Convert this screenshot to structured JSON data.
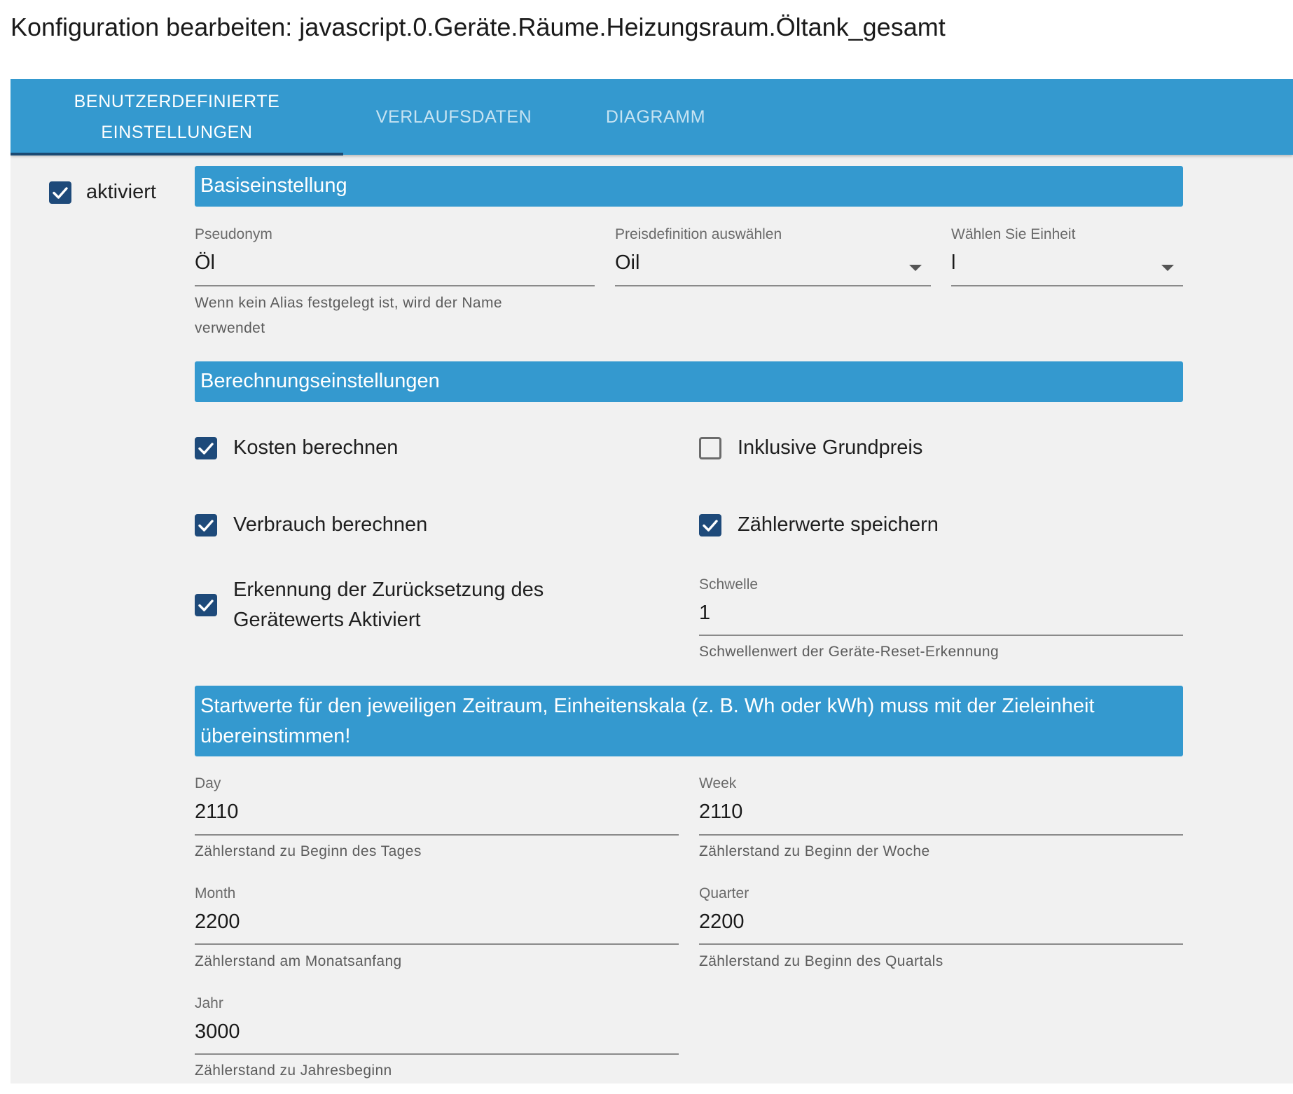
{
  "page": {
    "title": "Konfiguration bearbeiten: javascript.0.Geräte.Räume.Heizungsraum.Öltank_gesamt"
  },
  "tabs": [
    {
      "line1": "BENUTZERDEFINIERTE",
      "line2": "EINSTELLUNGEN",
      "active": true
    },
    {
      "label": "VERLAUFSDATEN",
      "active": false
    },
    {
      "label": "DIAGRAMM",
      "active": false
    }
  ],
  "enabled": {
    "label": "aktiviert",
    "checked": true
  },
  "basic": {
    "header": "Basiseinstellung",
    "alias": {
      "label": "Pseudonym",
      "value": "Öl",
      "helper": "Wenn kein Alias festgelegt ist, wird der Name verwendet"
    },
    "price": {
      "label": "Preisdefinition auswählen",
      "value": "Oil"
    },
    "unit": {
      "label": "Wählen Sie Einheit",
      "value": "l"
    }
  },
  "calc": {
    "header": "Berechnungseinstellungen",
    "costs": {
      "label": "Kosten berechnen",
      "checked": true
    },
    "base_price": {
      "label": "Inklusive Grundpreis",
      "checked": false
    },
    "consumption": {
      "label": "Verbrauch berechnen",
      "checked": true
    },
    "meter_values": {
      "label": "Zählerwerte speichern",
      "checked": true
    },
    "reset_detection": {
      "label": "Erkennung der Zurücksetzung des Gerätewerts Aktiviert",
      "checked": true
    },
    "threshold": {
      "label": "Schwelle",
      "value": "1",
      "helper": "Schwellenwert der Geräte-Reset-Erkennung"
    }
  },
  "start": {
    "header": "Startwerte für den jeweiligen Zeitraum, Einheitenskala (z. B. Wh oder kWh) muss mit der Zieleinheit übereinstimmen!",
    "day": {
      "label": "Day",
      "value": "2110",
      "helper": "Zählerstand zu Beginn des Tages"
    },
    "week": {
      "label": "Week",
      "value": "2110",
      "helper": "Zählerstand zu Beginn der Woche"
    },
    "month": {
      "label": "Month",
      "value": "2200",
      "helper": "Zählerstand am Monatsanfang"
    },
    "quarter": {
      "label": "Quarter",
      "value": "2200",
      "helper": "Zählerstand zu Beginn des Quartals"
    },
    "year": {
      "label": "Jahr",
      "value": "3000",
      "helper": "Zählerstand zu Jahresbeginn"
    }
  },
  "colors": {
    "accent": "#3499cf",
    "tab_indicator": "#1b4a72",
    "checkbox": "#1e4a7a",
    "panel_bg": "#f1f1f1"
  }
}
